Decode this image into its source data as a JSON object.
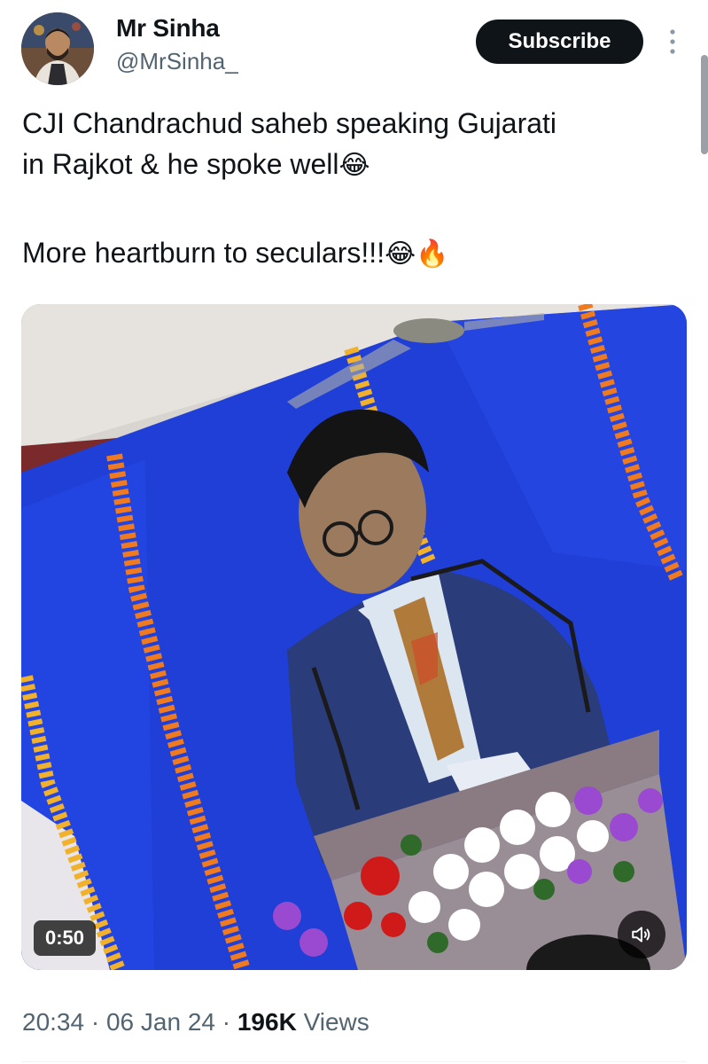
{
  "author": {
    "display_name": "Mr Sinha",
    "handle": "@MrSinha_",
    "avatar_icon": "profile-photo"
  },
  "actions": {
    "subscribe_label": "Subscribe",
    "more_icon": "more-vertical-icon"
  },
  "tweet": {
    "line1": "CJI Chandrachud saheb speaking Gujarati",
    "line2": "in Rajkot & he spoke well",
    "line2_emoji": "😂",
    "line3": "More heartburn to seculars!!!",
    "line3_emoji1": "😂",
    "line3_emoji2": "🔥"
  },
  "media": {
    "type": "video",
    "duration": "0:50",
    "mute_icon": "speaker-muted-icon"
  },
  "meta": {
    "time": "20:34",
    "sep1": " · ",
    "date": "06 Jan 24",
    "sep2": " · ",
    "views_count": "196K",
    "views_label": " Views"
  },
  "colors": {
    "text_primary": "#0f1419",
    "text_secondary": "#536471",
    "button_bg": "#0f1419",
    "screen_blue": "#1f3fd6",
    "garland_orange": "#f07a1e"
  }
}
